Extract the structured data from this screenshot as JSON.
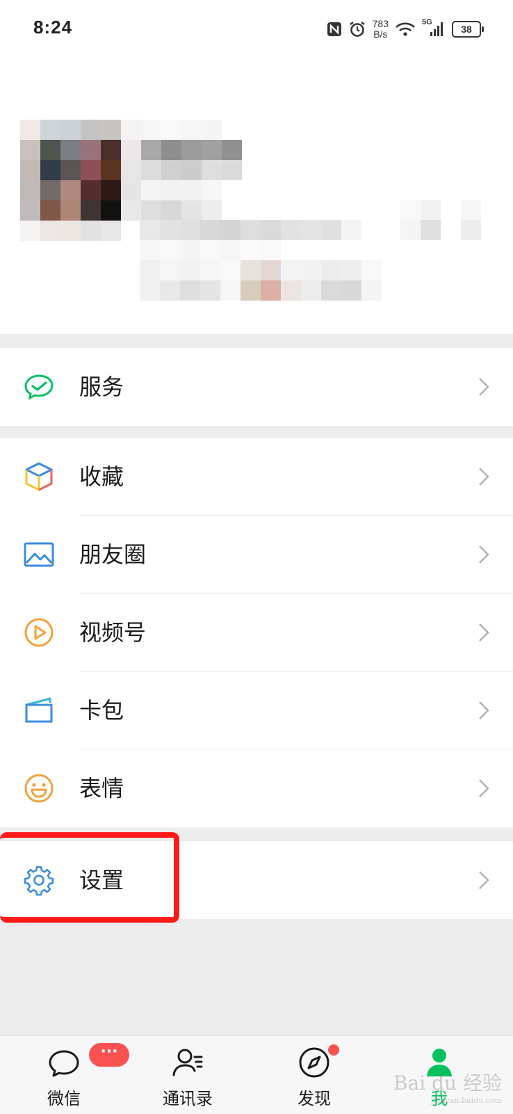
{
  "status_bar": {
    "time": "8:24",
    "net_speed_value": "783",
    "net_speed_unit": "B/s",
    "network": "5G",
    "battery": "38",
    "icons": [
      "nfc-icon",
      "alarm-icon",
      "wifi-icon",
      "signal-icon",
      "battery-icon"
    ]
  },
  "profile": {
    "avatar": "pixelated-avatar",
    "name": "",
    "blurred": true
  },
  "menu": {
    "service": {
      "label": "服务",
      "icon": "service-icon"
    },
    "group2": [
      {
        "label": "收藏",
        "icon": "favorites-icon"
      },
      {
        "label": "朋友圈",
        "icon": "moments-icon"
      },
      {
        "label": "视频号",
        "icon": "channels-icon"
      },
      {
        "label": "卡包",
        "icon": "card-wallet-icon"
      },
      {
        "label": "表情",
        "icon": "sticker-icon"
      }
    ],
    "settings": {
      "label": "设置",
      "icon": "gear-icon"
    }
  },
  "tabbar": {
    "tabs": [
      {
        "label": "微信",
        "icon": "chat-bubble-icon",
        "badge": "···"
      },
      {
        "label": "通讯录",
        "icon": "contacts-icon"
      },
      {
        "label": "发现",
        "icon": "compass-icon"
      },
      {
        "label": "我",
        "icon": "me-icon",
        "active": true
      }
    ]
  },
  "watermark": {
    "text": "Bai du 经验",
    "sub": "jingyan.baidu.com"
  },
  "colors": {
    "accent_green": "#07c160",
    "badge_red": "#fa5151",
    "highlight_red": "#ff1a1a",
    "background": "#ededed"
  }
}
